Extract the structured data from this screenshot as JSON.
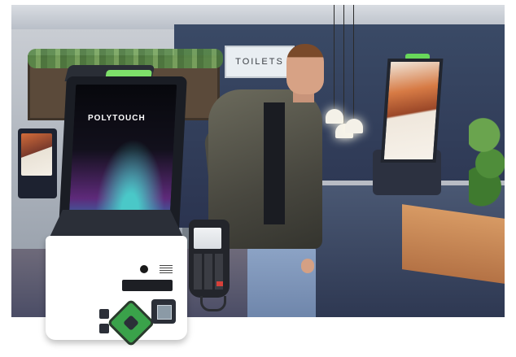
{
  "scene": {
    "kiosk_brand": "POLYTOUCH",
    "sign_text": "TOILETS"
  },
  "colors": {
    "accent_green": "#68d85a",
    "kiosk_body": "#ffffff",
    "kiosk_dark": "#2b2f38"
  }
}
